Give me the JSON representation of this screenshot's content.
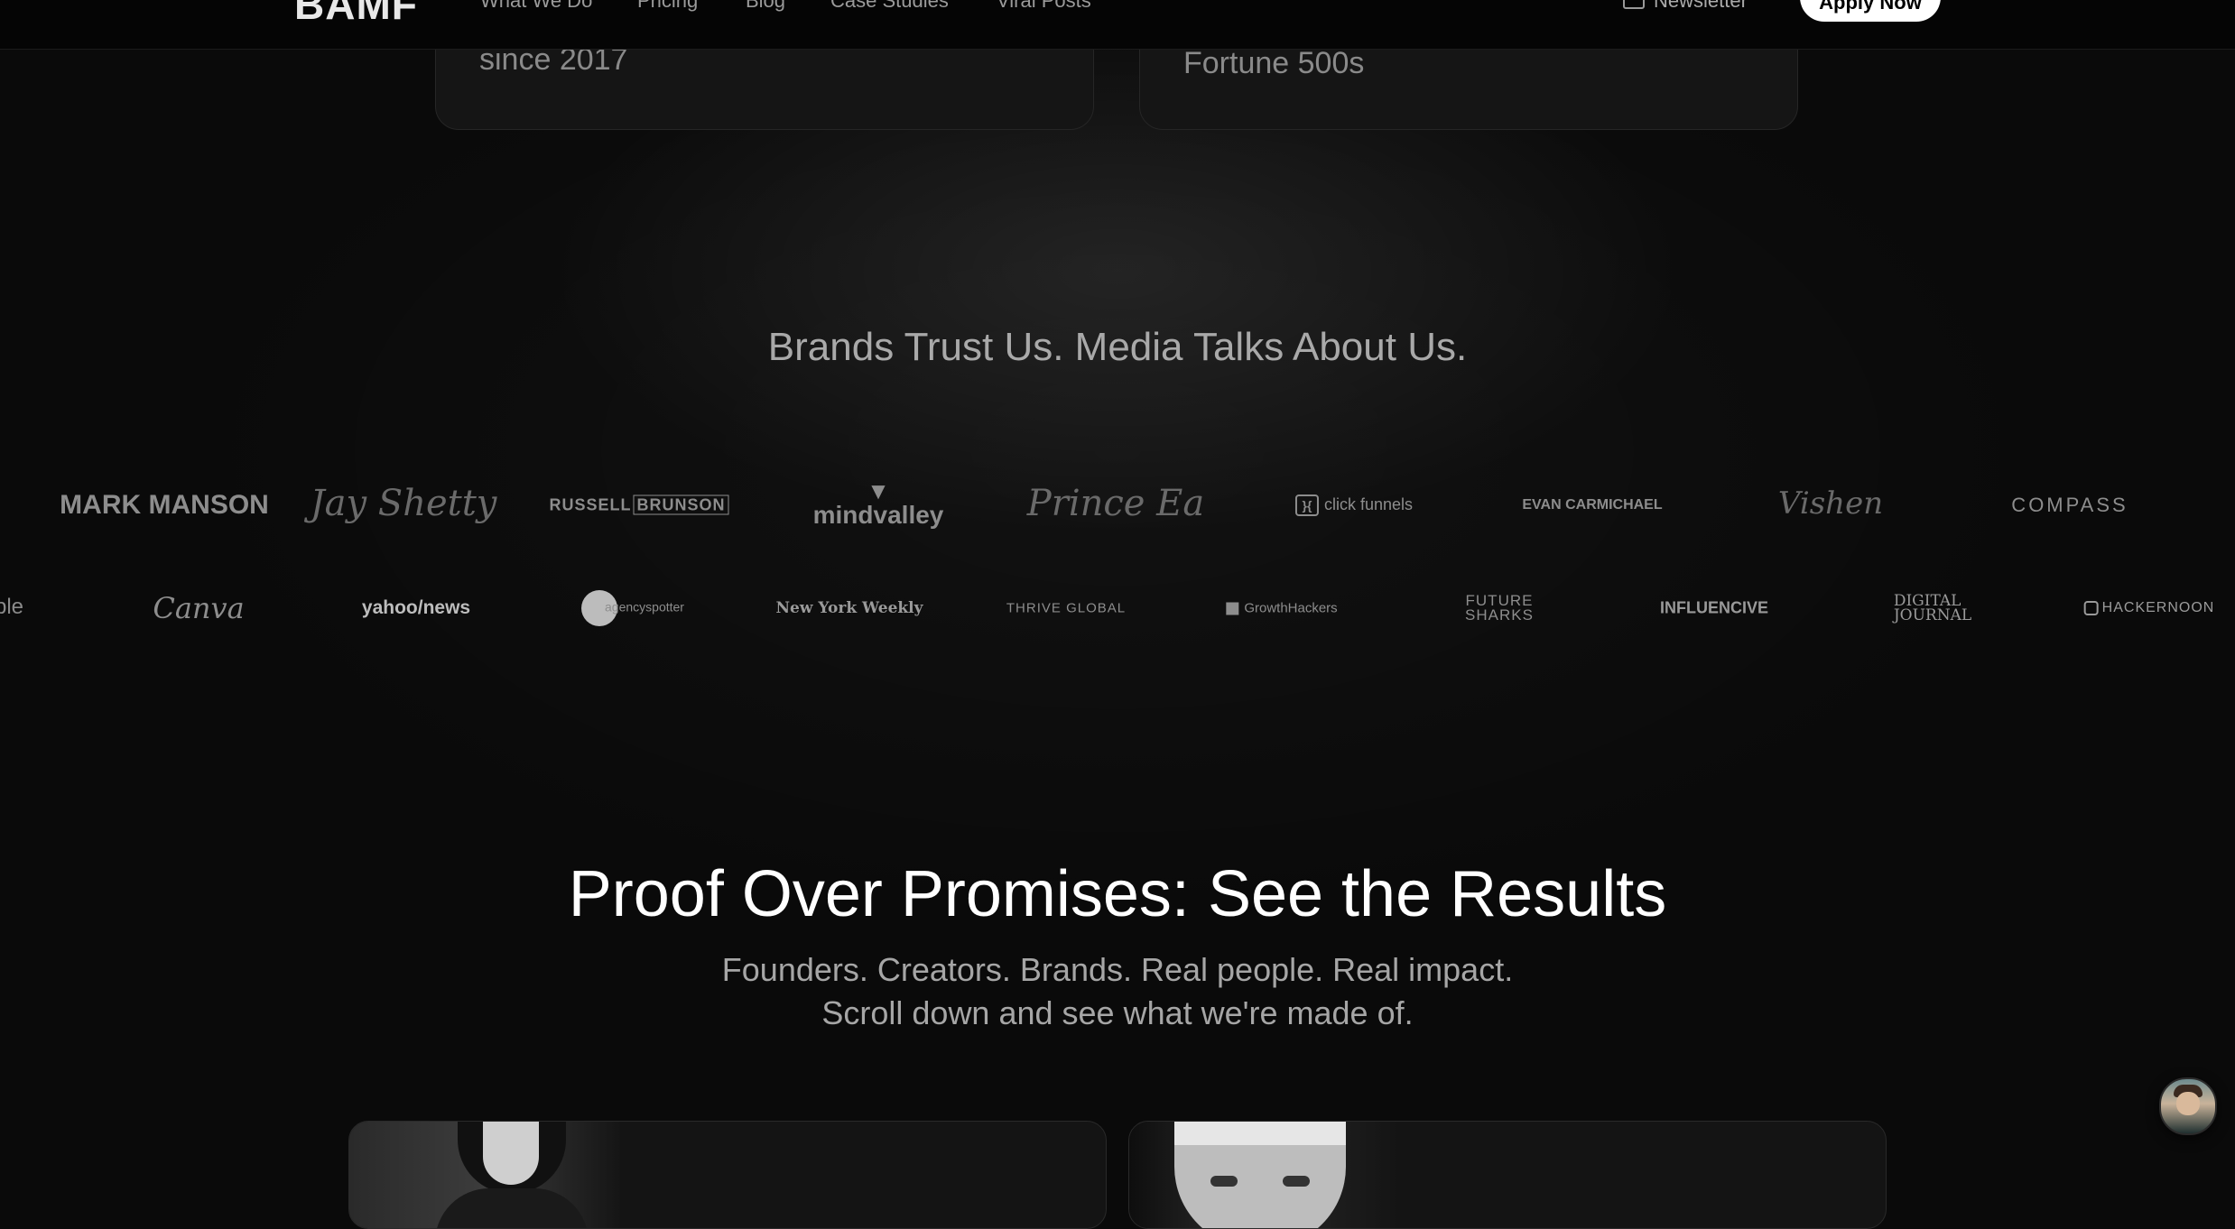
{
  "nav": {
    "logo": "BAMF",
    "links": [
      "What We Do",
      "Pricing",
      "Blog",
      "Case Studies",
      "Viral Posts"
    ],
    "newsletter": "Newsletter",
    "apply": "Apply Now"
  },
  "stats": [
    {
      "line1": "",
      "line2": "since 2017"
    },
    {
      "line1": "",
      "line2": "Fortune 500s"
    }
  ],
  "trust": {
    "heading": "Brands Trust Us. Media Talks About Us.",
    "row1": [
      "MARK MANSON",
      "Jay Shetty",
      "RUSSELL",
      "BRUNSON",
      "mindvalley",
      "Prince Ea",
      "click funnels",
      "EVAN CARMICHAEL",
      "Vishen",
      "COMPASS"
    ],
    "row2": [
      "ple",
      "Canva",
      "yahoo/news",
      "agencyspotter",
      "New York Weekly",
      "THRIVE GLOBAL",
      "GrowthHackers",
      "FUTURE",
      "SHARKS",
      "INFLUENCIVE",
      "DIGITAL",
      "JOURNAL",
      "HACKERNOON"
    ]
  },
  "results": {
    "title": "Proof Over Promises: See the Results",
    "subtitle_line1": "Founders. Creators. Brands. Real people. Real impact.",
    "subtitle_line2": "Scroll down and see what we're made of."
  },
  "icons": {
    "newsletter": "mail-icon",
    "mindvalley": "wings-icon",
    "clickfunnels": "clickfunnels-icon",
    "growthhackers": "square-icon",
    "hackernoon": "hexagon-icon",
    "chat": "avatar-chat-icon"
  }
}
